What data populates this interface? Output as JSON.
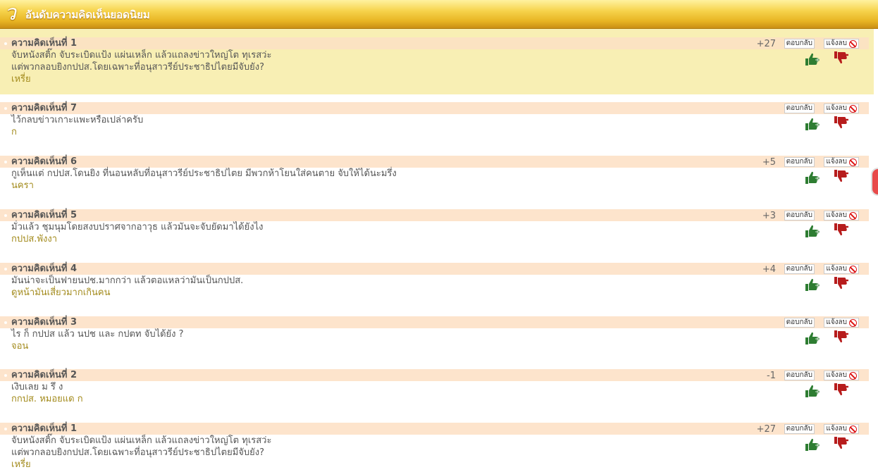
{
  "header": {
    "logo_glyph": "ว",
    "title": "อันดับความคิดเห็นยอดนิยม"
  },
  "buttons": {
    "reply": "ตอบกลับ",
    "report": "แจ้งลบ"
  },
  "icons": {
    "like": "thumbs-up-plus-icon",
    "dislike": "thumbs-down-minus-icon",
    "report": "ban-icon"
  },
  "colors": {
    "header": "#e8b423",
    "bar": "#fde4cc",
    "featured_bg": "#f8efb4",
    "author": "#a38b1d",
    "like": "#2e7d32",
    "dislike": "#b71c1c"
  },
  "comments": [
    {
      "title": "ความคิดเห็นที่ 1",
      "score": "+27",
      "lines": [
        "จับหนังสติ๊ก จับระเบิดแป้ง แผ่นเหล็ก แล้วแถลงข่าวใหญ่โต ทุเรสว่ะ",
        "แต่พวกลอบยิงกปปส.โดยเฉพาะที่อนุสาวรีย์ประชาธิปไตยมีจับยัง?"
      ],
      "author": "เหรี่ย"
    },
    {
      "title": "ความคิดเห็นที่ 7",
      "score": "",
      "lines": [
        "ไว้กลบข่าวเกาะแพะหรือเปล่าครับ"
      ],
      "author": "ก"
    },
    {
      "title": "ความคิดเห็นที่ 6",
      "score": "+5",
      "lines": [
        "กูเห็นแต่ กปปส.โดนยิง ที่นอนหลับที่อนุสาวรีย์ประชาธิปไตย มีพวกห้าโยนใส่คนตาย จับให้ได้นะมรึ่ง"
      ],
      "author": "นครา"
    },
    {
      "title": "ความคิดเห็นที่ 5",
      "score": "+3",
      "lines": [
        "มั่วแล้ว ชุมนุมโดยสงบปราศจากอาวุธ แล้วมันจะจับยัดมาได้ยังไง"
      ],
      "author": "กปปส.พังงา"
    },
    {
      "title": "ความคิดเห็นที่ 4",
      "score": "+4",
      "lines": [
        "มันน่าจะเป็นฟายนปช.มากกว่า แล้วตอแหลว่ามันเป็นกปปส."
      ],
      "author": "ดูหน้ามันเสี่ยวมากเกินคน"
    },
    {
      "title": "ความคิดเห็นที่ 3",
      "score": "",
      "lines": [
        "ไร ก็ กปปส แล้ว นปช และ กปตท จับได้ยัง ?"
      ],
      "author": "จอน"
    },
    {
      "title": "ความคิดเห็นที่ 2",
      "score": "-1",
      "lines": [
        "เงิบเลย ม รึ ง"
      ],
      "author": "กกปส. หมอยแด ก"
    },
    {
      "title": "ความคิดเห็นที่ 1",
      "score": "+27",
      "lines": [
        "จับหนังสติ๊ก จับระเบิดแป้ง แผ่นเหล็ก แล้วแถลงข่าวใหญ่โต ทุเรสว่ะ",
        "แต่พวกลอบยิงกปปส.โดยเฉพาะที่อนุสาวรีย์ประชาธิปไตยมีจับยัง?"
      ],
      "author": "เหรี่ย"
    }
  ]
}
